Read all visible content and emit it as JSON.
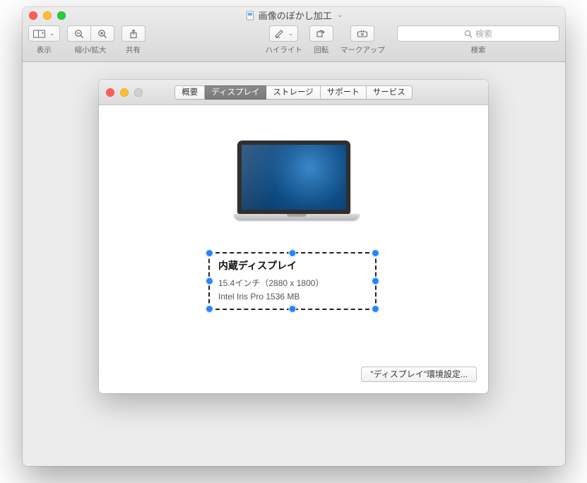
{
  "outer": {
    "title": "画像のぼかし加工",
    "toolbar": {
      "view": "表示",
      "zoom": "縮小/拡大",
      "share": "共有",
      "highlight": "ハイライト",
      "rotate": "回転",
      "markup": "マークアップ"
    },
    "search": {
      "placeholder": "検索",
      "label": "検索"
    }
  },
  "inner": {
    "tabs": {
      "overview": "概要",
      "display": "ディスプレイ",
      "storage": "ストレージ",
      "support": "サポート",
      "service": "サービス"
    },
    "info": {
      "title": "内蔵ディスプレイ",
      "size_line": "15.4インチ（2880 x 1800）",
      "gpu_line": "Intel Iris Pro 1536 MB"
    },
    "prefs_button": "\"ディスプレイ\"環境設定..."
  }
}
